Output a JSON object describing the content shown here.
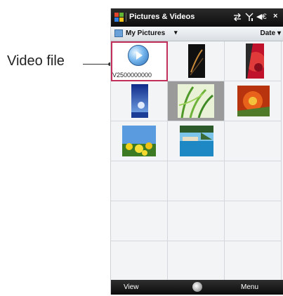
{
  "callout": {
    "label": "Video file"
  },
  "titlebar": {
    "title": "Pictures & Videos",
    "volume_glyph": "◀€",
    "close_glyph": "×",
    "icons": [
      "windows-logo-icon",
      "connectivity-icon",
      "signal-icon",
      "volume-icon",
      "close-icon"
    ]
  },
  "subbar": {
    "folder": "My Pictures",
    "caret": "▾",
    "sort": "Date ▾"
  },
  "grid": {
    "video_label": "V2500000000",
    "items": [
      {
        "type": "video",
        "name": "V2500000000"
      },
      {
        "type": "image",
        "name": "dark-portrait"
      },
      {
        "type": "image",
        "name": "red-abstract"
      },
      {
        "type": "image",
        "name": "blue-tall"
      },
      {
        "type": "image",
        "name": "grass-blades"
      },
      {
        "type": "image",
        "name": "orange-flower"
      },
      {
        "type": "image",
        "name": "yellow-flowers"
      },
      {
        "type": "image",
        "name": "pool-scene"
      }
    ]
  },
  "softkeys": {
    "left": "View",
    "right": "Menu"
  },
  "colors": {
    "selection": "#c0305a",
    "titlebar": "#0d0d0d",
    "grid": "#f3f4f6"
  }
}
